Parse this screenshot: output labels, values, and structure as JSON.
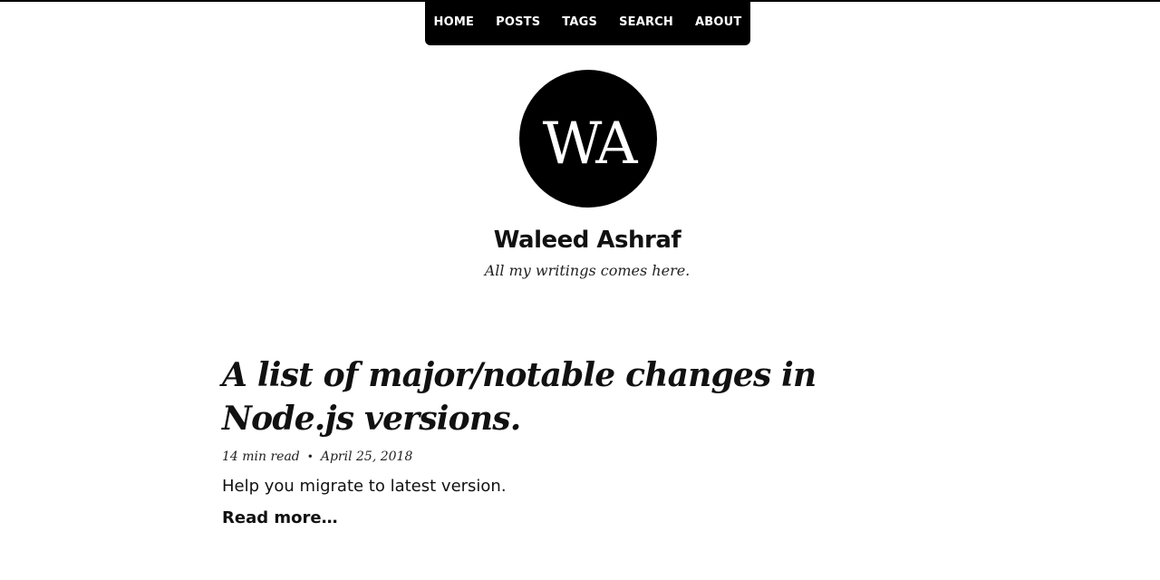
{
  "nav": {
    "items": [
      "HOME",
      "POSTS",
      "TAGS",
      "SEARCH",
      "ABOUT"
    ]
  },
  "avatar": {
    "initials": "WA"
  },
  "site": {
    "title": "Waleed Ashraf",
    "tagline": "All my writings comes here."
  },
  "post": {
    "title": "A list of major/notable changes in Node.js versions.",
    "read_time": "14 min read",
    "separator": "•",
    "date": "April 25, 2018",
    "excerpt": "Help you migrate to latest version.",
    "read_more": "Read more…"
  },
  "colors": {
    "background": "#ffffff",
    "nav_background": "#000000",
    "nav_text": "#ffffff",
    "text": "#111111"
  }
}
